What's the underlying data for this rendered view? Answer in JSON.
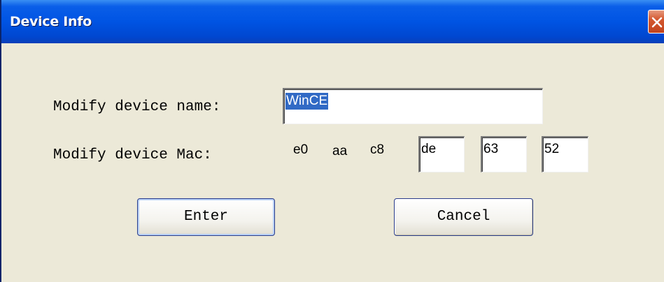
{
  "window": {
    "title": "Device Info"
  },
  "form": {
    "name_label": "Modify device name:",
    "name_value": "WinCE",
    "mac_label": "Modify device Mac:",
    "mac_fixed": [
      "e0",
      "aa",
      "c8"
    ],
    "mac_editable": [
      "de",
      "63",
      "52"
    ]
  },
  "buttons": {
    "enter_label": "Enter",
    "cancel_label": "Cancel"
  },
  "colors": {
    "titlebar": "#0054e3",
    "dialog_bg": "#ece9d8",
    "selection": "#316ac5",
    "close_button": "#d4582f"
  },
  "icons": {
    "close": "close-icon"
  }
}
